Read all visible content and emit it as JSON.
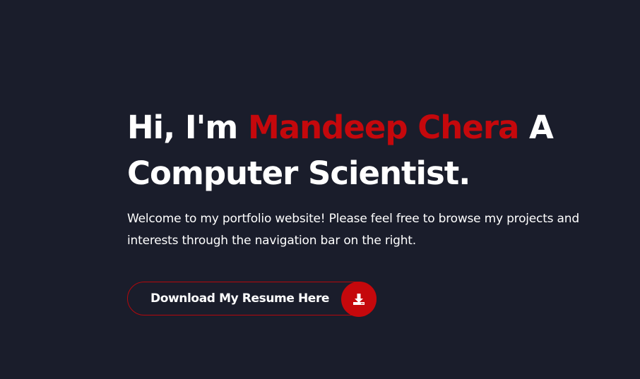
{
  "hero": {
    "greeting": "Hi, I'm ",
    "name": "Mandeep Chera",
    "role_line_1": " A",
    "role_line_2": "Computer Scientist.",
    "intro": "Welcome to my portfolio website! Please feel free to browse my projects and interests through the navigation bar on the right."
  },
  "resume_button": {
    "label": "Download My Resume Here",
    "icon": "download-icon"
  },
  "colors": {
    "background": "#1a1d2b",
    "accent": "#c5080c",
    "text": "#ffffff"
  }
}
